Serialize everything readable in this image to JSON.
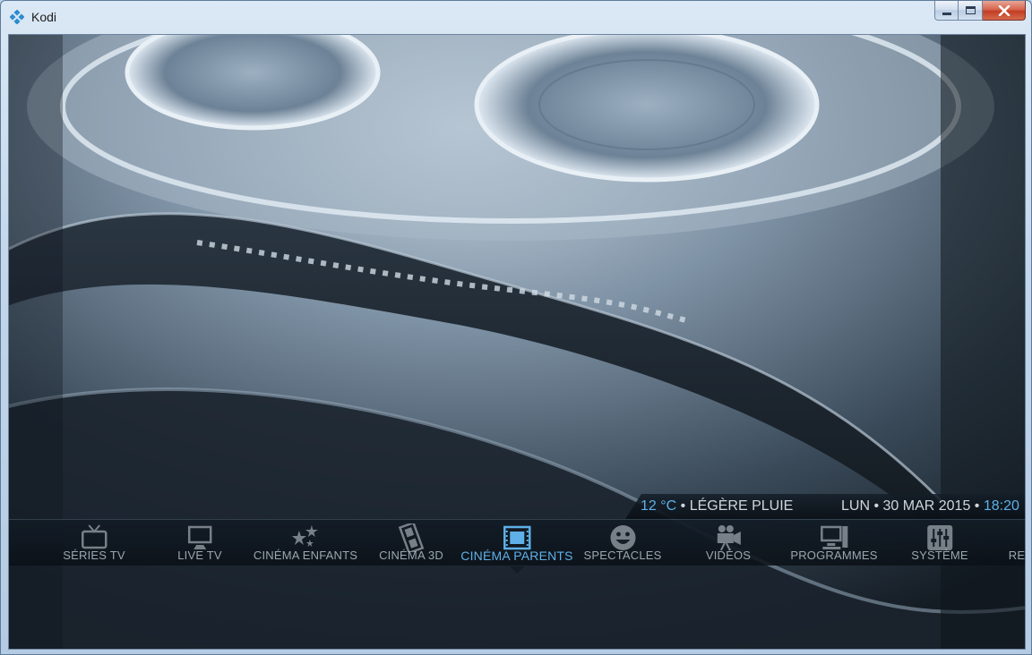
{
  "window": {
    "title": "Kodi",
    "controls": {
      "minimize": "minimize-icon",
      "maximize": "maximize-icon",
      "close": "close-icon"
    }
  },
  "info": {
    "temperature": "12 °C",
    "weather_sep": " • ",
    "condition": "LÉGÈRE PLUIE",
    "day": "LUN",
    "date_sep": " • ",
    "date": "30 MAR 2015",
    "time_sep": " • ",
    "time": "18:20"
  },
  "menu": {
    "items": [
      {
        "label": "SÉRIES TV",
        "icon": "tv-icon",
        "active": false
      },
      {
        "label": "LIVE TV",
        "icon": "monitor-icon",
        "active": false
      },
      {
        "label": "CINÉMA ENFANTS",
        "icon": "stars-icon",
        "active": false
      },
      {
        "label": "CINÉMA 3D",
        "icon": "film-strip-icon",
        "active": false
      },
      {
        "label": "CINÉMA PARENTS",
        "icon": "film-frame-icon",
        "active": true
      },
      {
        "label": "SPECTACLES",
        "icon": "smiley-icon",
        "active": false
      },
      {
        "label": "VIDÉOS",
        "icon": "video-camera-icon",
        "active": false
      },
      {
        "label": "PROGRAMMES",
        "icon": "computer-icon",
        "active": false
      },
      {
        "label": "SYSTÈME",
        "icon": "sliders-icon",
        "active": false
      },
      {
        "label": "RE",
        "icon": "",
        "active": false
      }
    ]
  },
  "colors": {
    "accent": "#5fb0e8",
    "text": "#cfd6dc",
    "menu_text": "#9aa6b0"
  }
}
